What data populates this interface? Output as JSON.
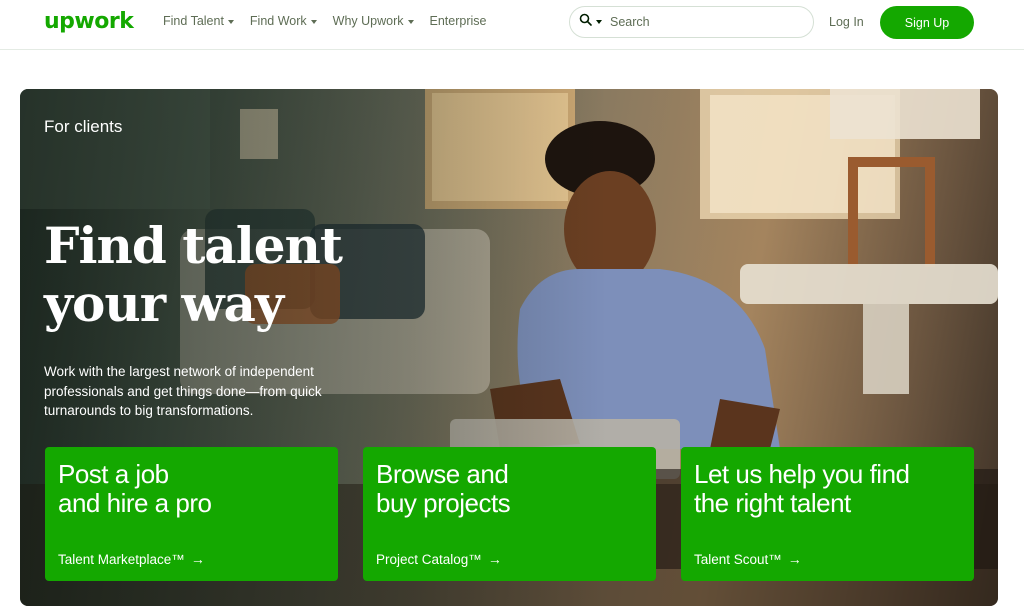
{
  "header": {
    "logo_text": "upwork",
    "nav": [
      {
        "label": "Find Talent",
        "has_caret": true
      },
      {
        "label": "Find Work",
        "has_caret": true
      },
      {
        "label": "Why Upwork",
        "has_caret": true
      },
      {
        "label": "Enterprise",
        "has_caret": false
      }
    ],
    "search": {
      "placeholder": "Search",
      "icon": "search-icon"
    },
    "login_label": "Log In",
    "signup_label": "Sign Up"
  },
  "hero": {
    "eyebrow": "For clients",
    "headline": "Find talent your way",
    "subtext": "Work with the largest network of independent professionals and get things done—from quick turnarounds to big transformations.",
    "cards": [
      {
        "title": "Post a job\nand hire a pro",
        "link": "Talent Marketplace™"
      },
      {
        "title": "Browse and\nbuy projects",
        "link": "Project Catalog™"
      },
      {
        "title": "Let us help you find\nthe right talent",
        "link": "Talent Scout™"
      }
    ]
  },
  "colors": {
    "brand": "#14a800",
    "text": "#001e00",
    "muted": "#5e6d55"
  }
}
